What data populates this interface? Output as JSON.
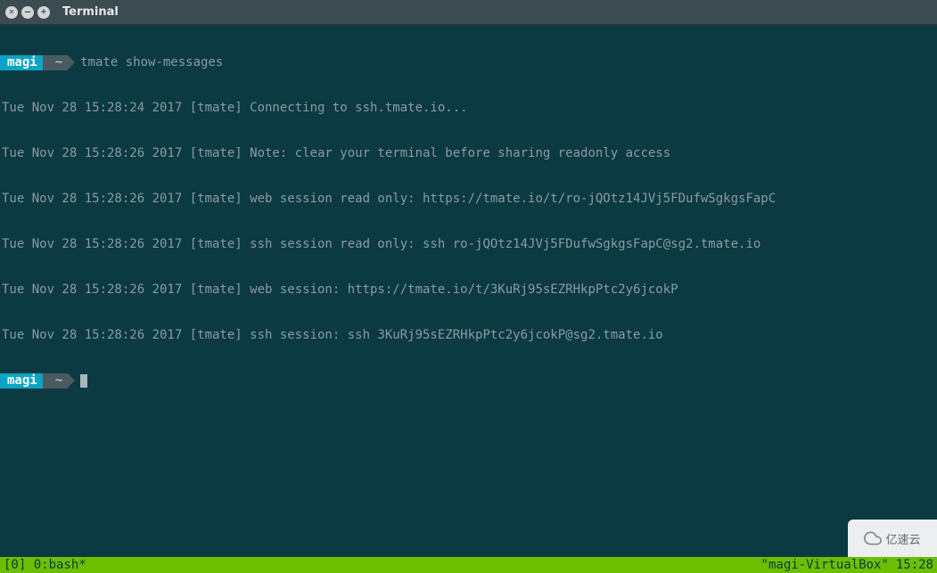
{
  "window": {
    "title": "Terminal"
  },
  "prompt1": {
    "user": "magi",
    "path": "~",
    "command": "tmate show-messages"
  },
  "output": {
    "line1": "Tue Nov 28 15:28:24 2017 [tmate] Connecting to ssh.tmate.io...",
    "line2": "Tue Nov 28 15:28:26 2017 [tmate] Note: clear your terminal before sharing readonly access",
    "line3": "Tue Nov 28 15:28:26 2017 [tmate] web session read only: https://tmate.io/t/ro-jQOtz14JVj5FDufwSgkgsFapC",
    "line4": "Tue Nov 28 15:28:26 2017 [tmate] ssh session read only: ssh ro-jQOtz14JVj5FDufwSgkgsFapC@sg2.tmate.io",
    "line5": "Tue Nov 28 15:28:26 2017 [tmate] web session: https://tmate.io/t/3KuRj95sEZRHkpPtc2y6jcokP",
    "line6": "Tue Nov 28 15:28:26 2017 [tmate] ssh session: ssh 3KuRj95sEZRHkpPtc2y6jcokP@sg2.tmate.io"
  },
  "prompt2": {
    "user": "magi",
    "path": "~"
  },
  "statusbar": {
    "left": "[0] 0:bash*",
    "host": "\"magi-VirtualBox\"",
    "time": "15:28"
  },
  "watermark": {
    "text": "亿速云"
  }
}
